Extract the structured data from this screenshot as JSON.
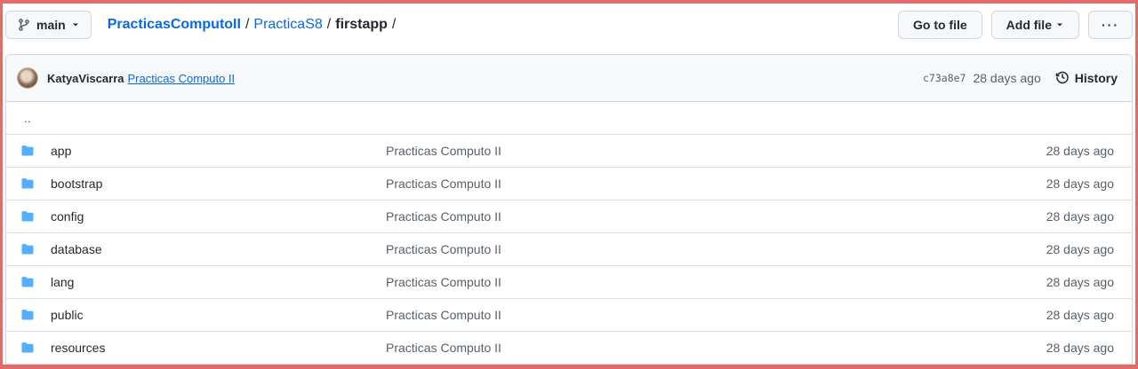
{
  "topbar": {
    "branch": "main",
    "breadcrumb": {
      "repo": "PracticasComputoII",
      "folder": "PracticaS8",
      "current": "firstapp",
      "separator": "/"
    },
    "go_to_file": "Go to file",
    "add_file": "Add file",
    "more": "···"
  },
  "commit": {
    "author": "KatyaViscarra",
    "message": "Practicas Computo II",
    "sha": "c73a8e7",
    "age": "28 days ago",
    "history": "History"
  },
  "parent_link": "..",
  "files": [
    {
      "name": "app",
      "message": "Practicas Computo II",
      "age": "28 days ago"
    },
    {
      "name": "bootstrap",
      "message": "Practicas Computo II",
      "age": "28 days ago"
    },
    {
      "name": "config",
      "message": "Practicas Computo II",
      "age": "28 days ago"
    },
    {
      "name": "database",
      "message": "Practicas Computo II",
      "age": "28 days ago"
    },
    {
      "name": "lang",
      "message": "Practicas Computo II",
      "age": "28 days ago"
    },
    {
      "name": "public",
      "message": "Practicas Computo II",
      "age": "28 days ago"
    },
    {
      "name": "resources",
      "message": "Practicas Computo II",
      "age": "28 days ago"
    }
  ],
  "colors": {
    "link": "#0969da",
    "folder": "#54aeff",
    "frame": "#e06c6c"
  }
}
